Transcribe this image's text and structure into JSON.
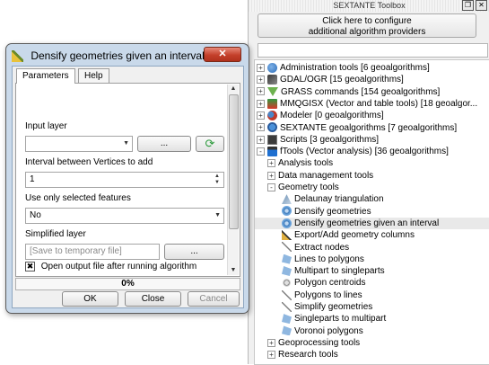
{
  "toolbox": {
    "title": "SEXTANTE Toolbox",
    "float_btn": "❐",
    "close_btn": "✕",
    "configure_line1": "Click here to configure",
    "configure_line2": "additional algorithm providers",
    "search_value": "",
    "tree": [
      {
        "label": "Administration tools [6 geoalgorithms]",
        "pm": "+",
        "icon": "admin-tools-icon",
        "depth": 0
      },
      {
        "label": "GDAL/OGR [15 geoalgorithms]",
        "pm": "+",
        "icon": "gdal-icon",
        "depth": 0
      },
      {
        "label": "GRASS commands [154 geoalgorithms]",
        "pm": "+",
        "icon": "grass-icon",
        "depth": 0
      },
      {
        "label": "MMQGISX (Vector and table tools) [18 geoalgor...",
        "pm": "+",
        "icon": "mmqgis-icon",
        "depth": 0
      },
      {
        "label": "Modeler [0 geoalgorithms]",
        "pm": "+",
        "icon": "modeler-icon",
        "depth": 0
      },
      {
        "label": "SEXTANTE geoalgorithms [7 geoalgorithms]",
        "pm": "+",
        "icon": "sextante-icon",
        "depth": 0
      },
      {
        "label": "Scripts [3 geoalgorithms]",
        "pm": "+",
        "icon": "scripts-icon",
        "depth": 0
      },
      {
        "label": "fTools (Vector analysis) [36 geoalgorithms]",
        "pm": "-",
        "icon": "ftools-icon",
        "depth": 0
      },
      {
        "label": "Analysis tools",
        "pm": "+",
        "icon": "",
        "depth": 1
      },
      {
        "label": "Data management tools",
        "pm": "+",
        "icon": "",
        "depth": 1
      },
      {
        "label": "Geometry tools",
        "pm": "-",
        "icon": "",
        "depth": 1
      },
      {
        "label": "Delaunay triangulation",
        "pm": "",
        "icon": "delaunay-icon",
        "depth": 2
      },
      {
        "label": "Densify geometries",
        "pm": "",
        "icon": "gear-icon",
        "depth": 2
      },
      {
        "label": "Densify geometries given an interval",
        "pm": "",
        "icon": "gear-icon",
        "depth": 2,
        "selected": true
      },
      {
        "label": "Export/Add geometry columns",
        "pm": "",
        "icon": "export-columns-icon",
        "depth": 2
      },
      {
        "label": "Extract nodes",
        "pm": "",
        "icon": "extract-nodes-icon",
        "depth": 2
      },
      {
        "label": "Lines to polygons",
        "pm": "",
        "icon": "lines-to-polygons-icon",
        "depth": 2
      },
      {
        "label": "Multipart to singleparts",
        "pm": "",
        "icon": "multipart-icon",
        "depth": 2
      },
      {
        "label": "Polygon centroids",
        "pm": "",
        "icon": "centroids-icon",
        "depth": 2
      },
      {
        "label": "Polygons to lines",
        "pm": "",
        "icon": "polygons-to-lines-icon",
        "depth": 2
      },
      {
        "label": "Simplify geometries",
        "pm": "",
        "icon": "simplify-icon",
        "depth": 2
      },
      {
        "label": "Singleparts to multipart",
        "pm": "",
        "icon": "singleparts-icon",
        "depth": 2
      },
      {
        "label": "Voronoi polygons",
        "pm": "",
        "icon": "voronoi-icon",
        "depth": 2
      },
      {
        "label": "Geoprocessing tools",
        "pm": "+",
        "icon": "",
        "depth": 1
      },
      {
        "label": "Research tools",
        "pm": "+",
        "icon": "",
        "depth": 1
      }
    ]
  },
  "dialog": {
    "title": "Densify geometries given an interval",
    "close_label": "✕",
    "tabs": {
      "parameters": "Parameters",
      "help": "Help"
    },
    "input_layer_label": "Input layer",
    "input_layer_value": "",
    "ellipsis": "...",
    "refresh_icon_glyph": "⟳",
    "interval_label": "Interval between Vertices to add",
    "interval_value": "1",
    "selected_only_label": "Use only selected features",
    "selected_only_value": "No",
    "simplified_label": "Simplified layer",
    "simplified_placeholder": "[Save to temporary file]",
    "open_output_label": "Open output file after running algorithm",
    "open_output_checked": "✖",
    "progress_text": "0%",
    "progress_fraction": 0.0,
    "ok": "OK",
    "close": "Close",
    "cancel": "Cancel"
  },
  "colors": {
    "selection": "#e9e9e9",
    "accent": "#4a8fe0",
    "close_button": "#c4402b"
  }
}
